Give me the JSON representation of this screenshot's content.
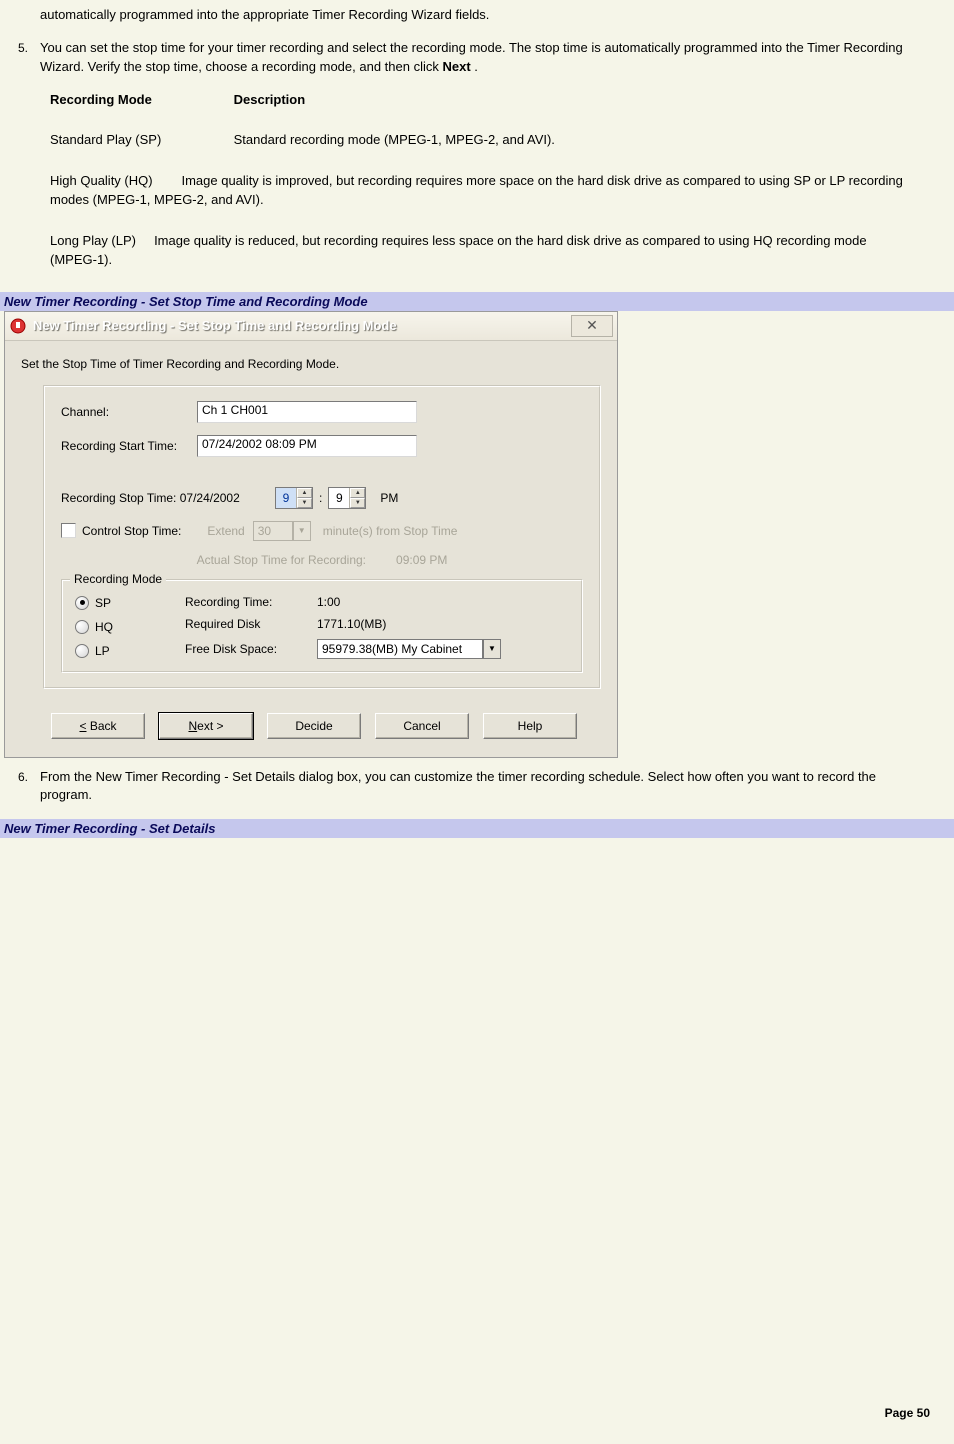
{
  "doc": {
    "frag_top": "automatically programmed into the appropriate Timer Recording Wizard fields.",
    "step5_marker": "5.",
    "step5_text_a": "You can set the stop time for your timer recording and select the recording mode. The stop time is automatically programmed into the Timer Recording Wizard. Verify the stop time, choose a recording mode, and then click ",
    "step5_text_b": "Next",
    "step5_text_c": " .",
    "table": {
      "h1": "Recording Mode",
      "h2": "Description",
      "r1c1": "Standard Play (SP)",
      "r1c2": "Standard recording mode (MPEG-1, MPEG-2, and AVI).",
      "r2c1": "High Quality (HQ)",
      "r2": "Image quality is improved, but recording requires more space on the hard disk drive as compared to using SP or LP recording modes (MPEG-1, MPEG-2, and AVI).",
      "r3c1": "Long Play (LP)",
      "r3": "Image quality is reduced, but recording requires less space on the hard disk drive as compared to using HQ recording mode (MPEG-1)."
    },
    "caption1": "New Timer Recording - Set Stop Time and Recording Mode",
    "step6_marker": "6.",
    "step6_text": "From the New Timer Recording - Set Details dialog box, you can customize the timer recording schedule. Select how often you want to record the program.",
    "caption2": "New Timer Recording - Set Details",
    "page_num": "Page 50"
  },
  "dialog": {
    "title": "New Timer Recording - Set Stop Time and Recording Mode",
    "instr": "Set the Stop Time of Timer Recording and Recording Mode.",
    "channel_label": "Channel:",
    "channel_value": "Ch 1 CH001",
    "start_label": "Recording Start Time:",
    "start_value": "07/24/2002 08:09 PM",
    "stop_label": "Recording Stop Time: 07/24/2002",
    "stop_h": "9",
    "stop_m": "9",
    "stop_ampm": "PM",
    "ctrl_stop_label": "Control Stop Time:",
    "extend_label": "Extend",
    "extend_value": "30",
    "extend_suffix": "minute(s) from Stop Time",
    "actual_label": "Actual Stop Time for Recording:",
    "actual_value": "09:09 PM",
    "group_title": "Recording Mode",
    "radio_sp": "SP",
    "radio_hq": "HQ",
    "radio_lp": "LP",
    "rec_time_label": "Recording Time:",
    "rec_time_value": "1:00",
    "req_disk_label": "Required Disk",
    "req_disk_value": "1771.10(MB)",
    "free_disk_label": "Free Disk Space:",
    "free_disk_value": "95979.38(MB) My Cabinet",
    "btn_back": "< Back",
    "btn_next": "Next >",
    "btn_decide": "Decide",
    "btn_cancel": "Cancel",
    "btn_help": "Help"
  }
}
